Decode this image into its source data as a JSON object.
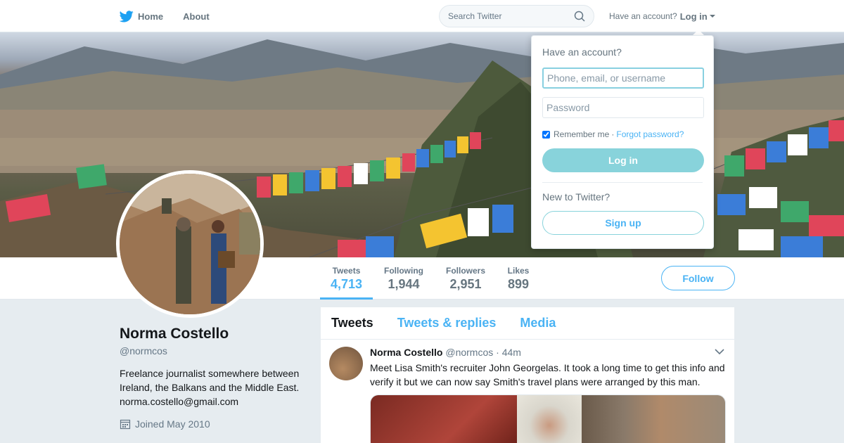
{
  "nav": {
    "home_label": "Home",
    "about_label": "About",
    "search_placeholder": "Search Twitter",
    "have_account": "Have an account?",
    "login_label": "Log in"
  },
  "stats": [
    {
      "label": "Tweets",
      "value": "4,713"
    },
    {
      "label": "Following",
      "value": "1,944"
    },
    {
      "label": "Followers",
      "value": "2,951"
    },
    {
      "label": "Likes",
      "value": "899"
    }
  ],
  "follow_label": "Follow",
  "profile": {
    "name": "Norma Costello",
    "handle": "@normcos",
    "bio_line1": "Freelance journalist somewhere between",
    "bio_line2": "Ireland, the Balkans and the Middle East.",
    "bio_line3": "norma.costello@gmail.com",
    "joined": "Joined May 2010"
  },
  "timeline": {
    "tabs": [
      "Tweets",
      "Tweets & replies",
      "Media"
    ],
    "tweet": {
      "name": "Norma Costello",
      "handle": "@normcos",
      "time": "· 44m",
      "text": "Meet Lisa Smith's recruiter John Georgelas. It took a long time to get this info and verify it but we can now say Smith's travel plans were arranged by this man."
    }
  },
  "login_dropdown": {
    "title": "Have an account?",
    "username_placeholder": "Phone, email, or username",
    "password_placeholder": "Password",
    "remember_label": "Remember me",
    "separator": "·",
    "forgot_label": "Forgot password?",
    "login_button": "Log in",
    "new_label": "New to Twitter?",
    "signup_button": "Sign up"
  },
  "colors": {
    "accent": "#4ab3f4",
    "login_button_bg": "#88d3db"
  }
}
